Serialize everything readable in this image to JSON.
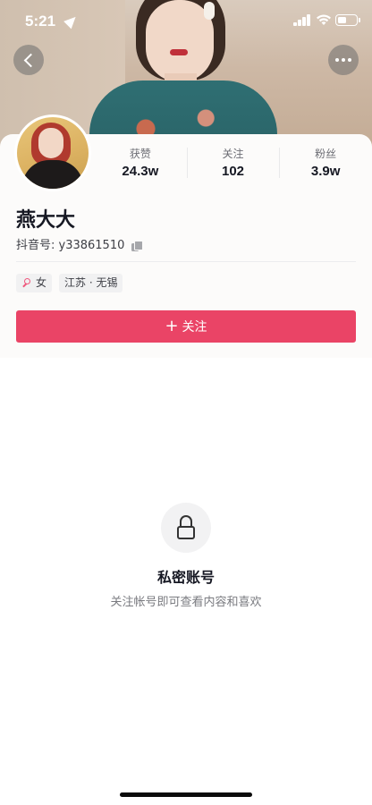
{
  "status_bar": {
    "time": "5:21"
  },
  "profile": {
    "name": "燕大大",
    "account_label": "抖音号: y33861510",
    "stats": [
      {
        "label": "获赞",
        "value": "24.3w"
      },
      {
        "label": "关注",
        "value": "102"
      },
      {
        "label": "粉丝",
        "value": "3.9w"
      }
    ],
    "tags": {
      "gender": "女",
      "location": "江苏 · 无锡"
    },
    "follow_button": {
      "icon": "+",
      "label": "关注"
    }
  },
  "private_section": {
    "title": "私密账号",
    "description": "关注帐号即可查看内容和喜欢"
  },
  "colors": {
    "follow_button": "#ea4466",
    "gender_icon": "#f0567c",
    "text_primary": "#161823",
    "text_secondary": "#7a7b80"
  },
  "icons": [
    "location-arrow-icon",
    "signal-icon",
    "wifi-icon",
    "battery-icon",
    "back-chevron-icon",
    "more-dots-icon",
    "copy-icon",
    "female-icon",
    "plus-icon",
    "lock-icon"
  ]
}
